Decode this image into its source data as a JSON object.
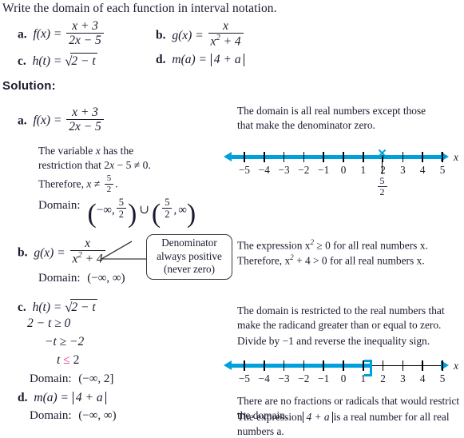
{
  "prompt": "Write the domain of each function in interval notation.",
  "solution_label": "Solution:",
  "problems": {
    "a": {
      "label": "a.",
      "fn": "f(x) =",
      "num": "x + 3",
      "den": "2x − 5"
    },
    "b": {
      "label": "b.",
      "fn": "g(x) =",
      "num": "x",
      "den_base": "x",
      "den_exp": "2",
      "den_rest": "+ 4"
    },
    "c": {
      "label": "c.",
      "fn": "h(t) =",
      "radical": "√",
      "radicand": "2 − t"
    },
    "d": {
      "label": "d.",
      "fn": "m(a) =",
      "abs": "4 + a"
    }
  },
  "solution_a": {
    "label": "a.",
    "fn": "f(x) =",
    "num": "x + 3",
    "den": "2x − 5",
    "line1": "The variable x has the",
    "line2_pre": "restriction that 2x − 5 ≠ 0.",
    "line3_pre": "Therefore, x ≠",
    "line3_frac_num": "5",
    "line3_frac_den": "2",
    "line3_post": ".",
    "domain_label": "Domain:",
    "interval_left_open": "(",
    "neg_inf": "−∞",
    "comma": ",",
    "frac_num": "5",
    "frac_den": "2",
    "interval_right": ")",
    "union": "∪",
    "pos_inf": "∞",
    "note1": "The domain is all real numbers except those",
    "note2": "that make the denominator zero."
  },
  "solution_b": {
    "label": "b.",
    "fn": "g(x) =",
    "num": "x",
    "den_base": "x",
    "den_exp": "2",
    "den_rest": "+ 4",
    "domain_label": "Domain:",
    "domain_value": "(−∞, ∞)",
    "callout_line1": "Denominator",
    "callout_line2": "always positive",
    "callout_line3": "(never zero)",
    "note1_pre": "The expression x",
    "note1_exp": "2",
    "note1_post": "≥ 0 for all real numbers x.",
    "note2_pre": "Therefore, x",
    "note2_exp": "2",
    "note2_post": "+ 4 > 0 for all real numbers x."
  },
  "solution_c": {
    "label": "c.",
    "fn": "h(t) =",
    "radical": "√",
    "radicand": "2 − t",
    "step1": "2 − t ≥ 0",
    "step2": "−t ≥ −2",
    "step3_pre": "t",
    "step3_sym": "≤",
    "step3_post": "2",
    "domain_label": "Domain:",
    "domain_value": "(−∞, 2]",
    "note1": "The domain is restricted to the real numbers that",
    "note2": "make the radicand greater than or equal to zero.",
    "note3": "Divide by −1 and reverse the inequality sign."
  },
  "solution_d": {
    "label": "d.",
    "fn": "m(a) =",
    "abs": "4 + a",
    "domain_label": "Domain:",
    "domain_value": "(−∞, ∞)",
    "note1": "There are no fractions or radicals that would restrict the domain.",
    "note2_pre": "The expression",
    "note2_abs": "4 + a",
    "note2_post": "is a real number for all real numbers a."
  },
  "numberline1": {
    "ticks": [
      "−5",
      "−4",
      "−3",
      "−2",
      "−1",
      "0",
      "1",
      "2",
      "3",
      "4",
      "5"
    ],
    "axis_label": "x",
    "exclude_marker": "✕",
    "exclude_value_num": "5",
    "exclude_value_den": "2",
    "highlight_color": "#00A0DC"
  },
  "numberline2": {
    "ticks": [
      "−5",
      "−4",
      "−3",
      "−2",
      "−1",
      "0",
      "1",
      "2",
      "3",
      "4",
      "5"
    ],
    "axis_label": "x",
    "bracket_at": "2",
    "highlight_color": "#00A0DC"
  },
  "colors": {
    "solution_heading": "#D8562A",
    "cyan": "#00A0DC",
    "magenta": "#E0218A",
    "text": "#1a1a2e"
  }
}
